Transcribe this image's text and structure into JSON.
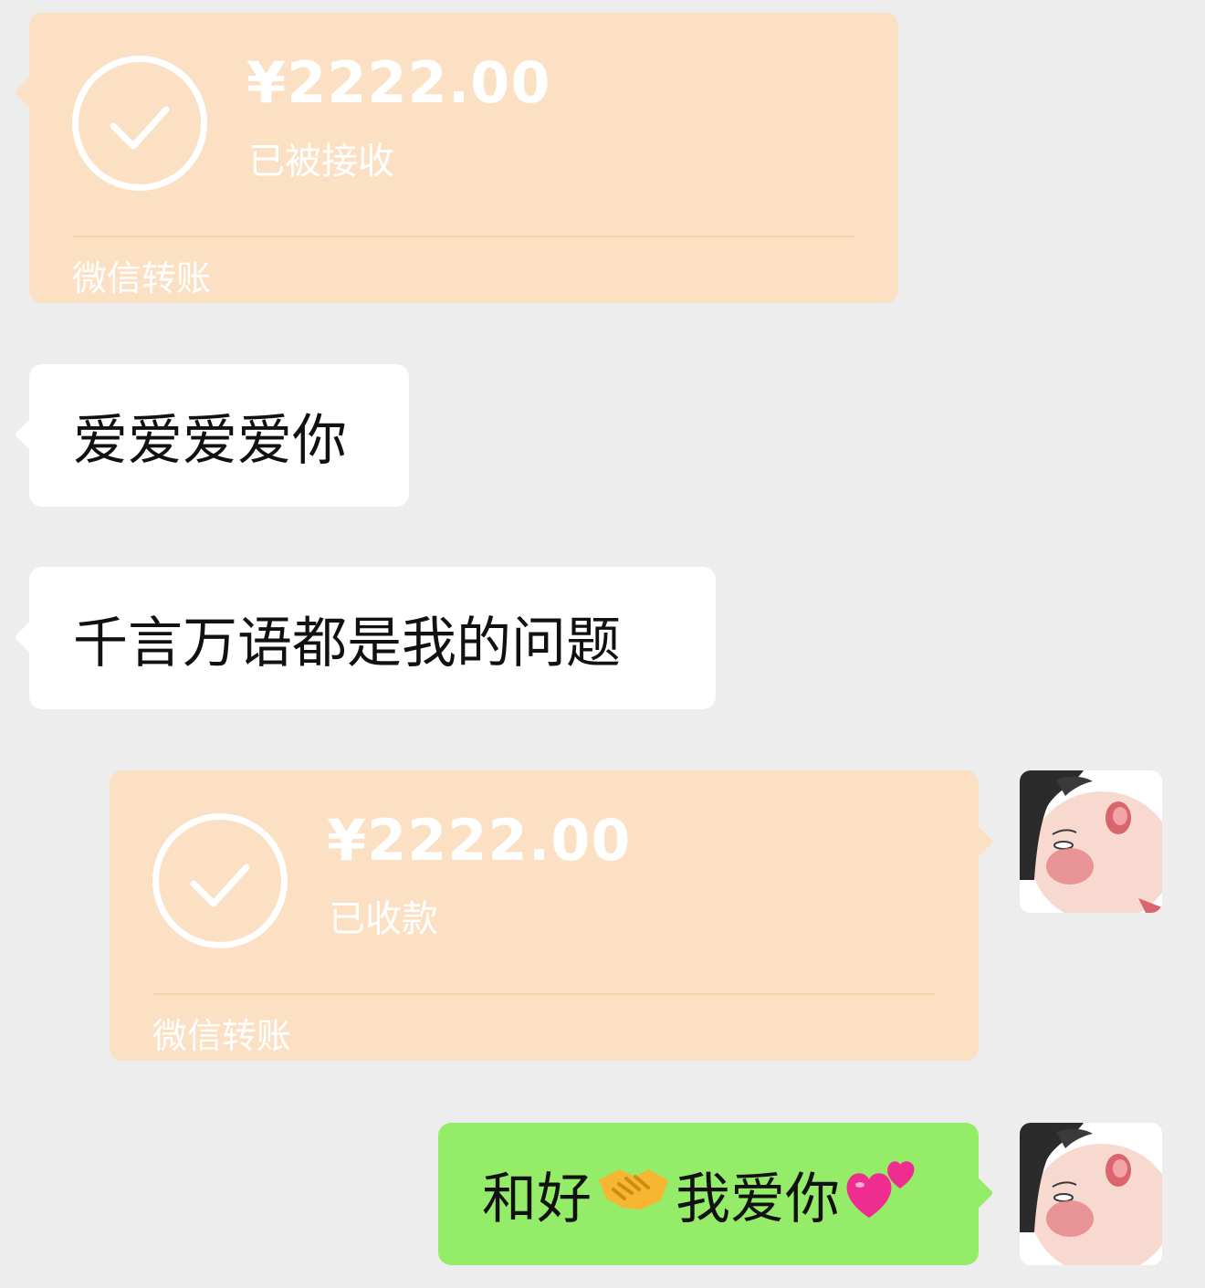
{
  "messages": [
    {
      "type": "transfer",
      "side": "left",
      "amount": "¥2222.00",
      "status": "已被接收",
      "footer": "微信转账"
    },
    {
      "type": "text",
      "side": "left",
      "text": "爱爱爱爱你"
    },
    {
      "type": "text",
      "side": "left",
      "text": "千言万语都是我的问题"
    },
    {
      "type": "transfer",
      "side": "right",
      "amount": "¥2222.00",
      "status": "已收款",
      "footer": "微信转账"
    },
    {
      "type": "text",
      "side": "right",
      "text_before": "和好",
      "emoji_1": "handshake-emoji",
      "text_after": "我爱你",
      "emoji_2": "two-hearts-emoji"
    }
  ],
  "icons": {
    "transfer_icon": "checkmark-circle-icon"
  },
  "colors": {
    "background": "#ededed",
    "transfer_card": "#fbe0c3",
    "received_bubble": "#ffffff",
    "sent_bubble": "#95ec69"
  }
}
